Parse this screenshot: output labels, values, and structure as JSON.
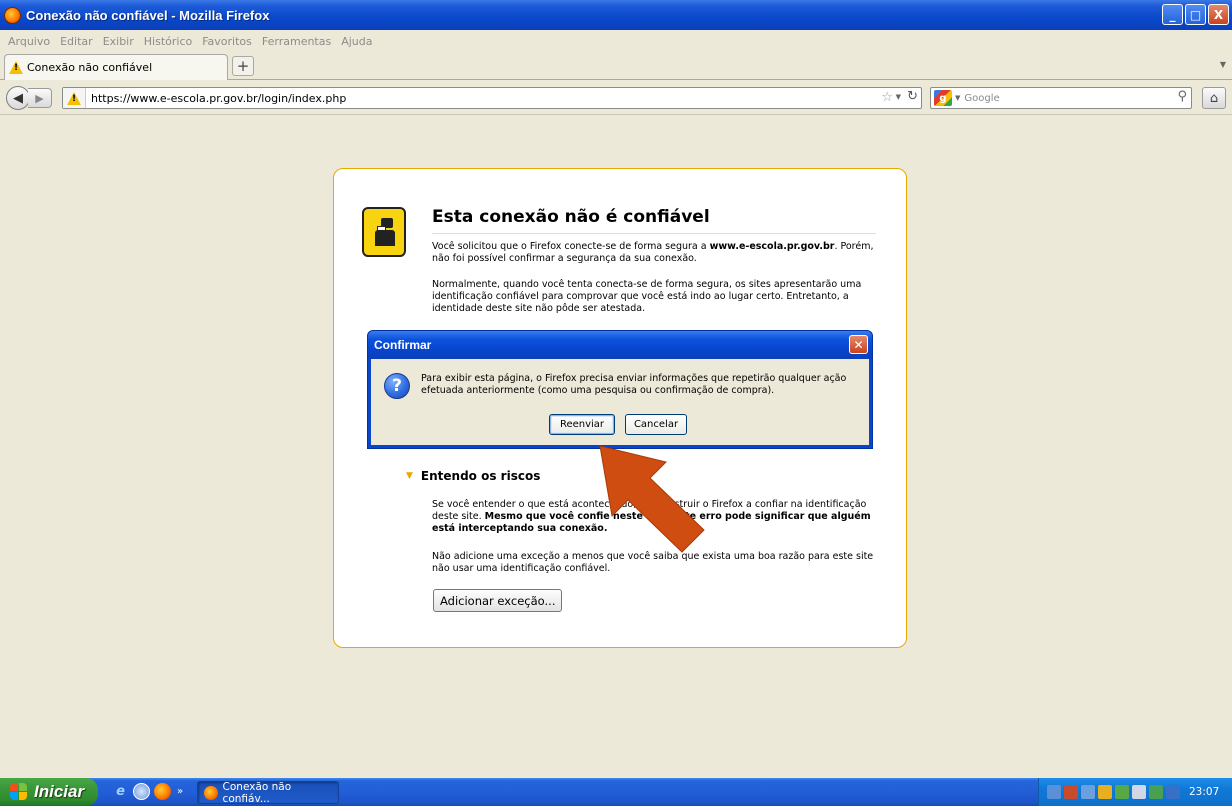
{
  "window": {
    "title": "Conexão não confiável - Mozilla Firefox",
    "buttons": {
      "minimize": "_",
      "maximize": "□",
      "close": "X"
    }
  },
  "menubar": [
    "Arquivo",
    "Editar",
    "Exibir",
    "Histórico",
    "Favoritos",
    "Ferramentas",
    "Ajuda"
  ],
  "tab": {
    "label": "Conexão não confiável",
    "new_tab": "+"
  },
  "navbar": {
    "url": "https://www.e-escola.pr.gov.br/login/index.php",
    "search_placeholder": "Google"
  },
  "page": {
    "title": "Esta conexão não é confiável",
    "p1_prefix": "Você solicitou que o Firefox conecte-se de forma segura a ",
    "p1_host": "www.e-escola.pr.gov.br",
    "p1_suffix": ". Porém, não foi possível confirmar a segurança da sua conexão.",
    "p2": "Normalmente, quando você tenta conecta-se de forma segura, os sites apresentarão uma identificação confiável para comprovar que você está indo ao lugar certo. Entretanto, a identidade deste site não pôde ser atestada.",
    "risks_heading": "Entendo os riscos",
    "p3_prefix": "Se você entender o que está acontecendo, pode instruir o Firefox a confiar na identificação deste site. ",
    "p3_bold": "Mesmo que você confie neste site, este erro pode significar que alguém está interceptando sua conexão.",
    "p4": "Não adicione uma exceção a menos que você saiba que exista uma boa razão para este site não usar uma identificação confiável.",
    "add_exception": "Adicionar exceção..."
  },
  "dialog": {
    "title": "Confirmar",
    "message": "Para exibir esta página, o Firefox precisa enviar informações que repetirão qualquer ação efetuada anteriormente (como uma pesquisa ou confirmação de compra).",
    "resend": "Reenviar",
    "cancel": "Cancelar"
  },
  "taskbar": {
    "start": "Iniciar",
    "task_label": "Conexão não confiáv...",
    "clock": "23:07",
    "more": "»"
  },
  "colors": {
    "accent_arrow": "#cf4d10",
    "dialog_title": "#0a46c9",
    "error_border": "#e9a900"
  }
}
